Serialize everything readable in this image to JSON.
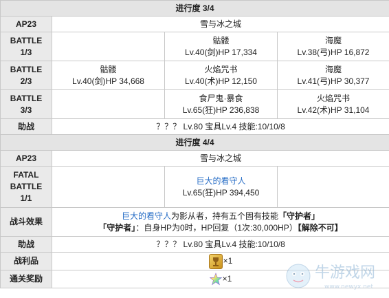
{
  "section1": {
    "title": "进行度 3/4",
    "ap": "AP23",
    "location": "雪与冰之城",
    "battle1": {
      "label1": "BATTLE",
      "label2": "1/3",
      "enemy2_name": "骷髅",
      "enemy2_stats": "Lv.40(剑)HP 17,334",
      "enemy3_name": "海魔",
      "enemy3_stats": "Lv.38(弓)HP 16,872"
    },
    "battle2": {
      "label1": "BATTLE",
      "label2": "2/3",
      "enemy1_name": "骷髅",
      "enemy1_stats": "Lv.40(剑)HP 34,668",
      "enemy2_name": "火焰咒书",
      "enemy2_stats": "Lv.40(术)HP 12,150",
      "enemy3_name": "海魔",
      "enemy3_stats": "Lv.41(弓)HP 30,377"
    },
    "battle3": {
      "label1": "BATTLE",
      "label2": "3/3",
      "enemy2_name": "食尸鬼·暴食",
      "enemy2_stats": "Lv.65(狂)HP 236,838",
      "enemy3_name": "火焰咒书",
      "enemy3_stats": "Lv.42(术)HP 31,104"
    },
    "support_label": "助战",
    "support_value": "？？？ Lv.80 宝具Lv.4 技能:10/10/8"
  },
  "section2": {
    "title": "进行度 4/4",
    "ap": "AP23",
    "location": "雪与冰之城",
    "final_label1": "FATAL",
    "final_label2": "BATTLE",
    "final_label3": "1/1",
    "boss_name": "巨大的看守人",
    "boss_stats": "Lv.65(狂)HP 394,450",
    "effect_label": "战斗效果",
    "effect_line1_link": "巨大的看守人",
    "effect_line1_text": "为影从者，持有五个固有技能",
    "effect_line1_bold": "「守护者」",
    "effect_line2_bold": "「守护者」",
    "effect_line2_text": "：自身HP为0时，HP回复（1次:30,000HP）",
    "effect_line2_tail": "【解除不可】",
    "support_label": "助战",
    "support_value": "？？？ Lv.80 宝具Lv.4 技能:10/10/8",
    "drops_label": "战利品",
    "drops_value": "×1",
    "reward_label": "通关奖励",
    "reward_value": "×1"
  },
  "icons": {
    "drop": "gold-cup-icon",
    "reward": "rainbow-star-icon"
  },
  "colors": {
    "header_bg": "#e4e4e4",
    "label_bg": "#eaeaea",
    "link": "#2a6fc7",
    "border": "#c8c8c8"
  },
  "watermark": {
    "text": "牛游戏网",
    "url": "www.newyx.net"
  }
}
